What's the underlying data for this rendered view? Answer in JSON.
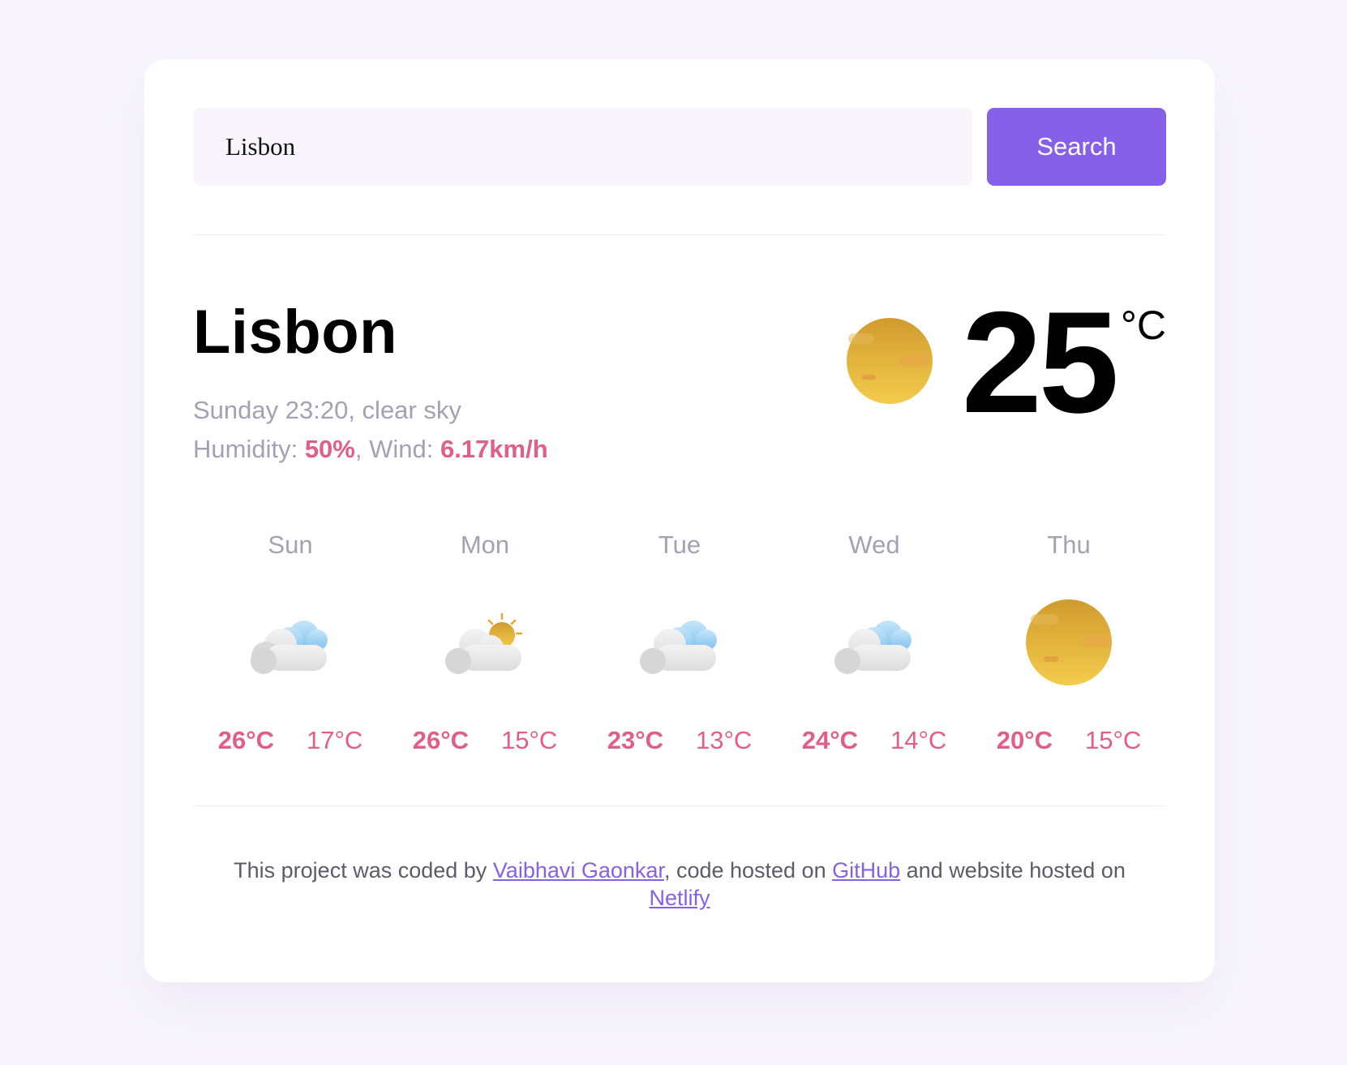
{
  "search": {
    "value": "Lisbon",
    "button_label": "Search"
  },
  "current": {
    "city": "Lisbon",
    "description": "Sunday 23:20, clear sky",
    "humidity_label": "Humidity: ",
    "humidity_value": "50%",
    "wind_label": ", Wind: ",
    "wind_value": "6.17km/h",
    "temperature": "25",
    "unit": "°C",
    "icon": "sun-icon"
  },
  "forecast": [
    {
      "day": "Sun",
      "icon": "cloud-icon",
      "max": "26°C",
      "min": "17°C"
    },
    {
      "day": "Mon",
      "icon": "partly-sunny-icon",
      "max": "26°C",
      "min": "15°C"
    },
    {
      "day": "Tue",
      "icon": "cloud-icon",
      "max": "23°C",
      "min": "13°C"
    },
    {
      "day": "Wed",
      "icon": "cloud-icon",
      "max": "24°C",
      "min": "14°C"
    },
    {
      "day": "Thu",
      "icon": "sun-icon",
      "max": "20°C",
      "min": "15°C"
    }
  ],
  "footer": {
    "prefix": "This project was coded by ",
    "author": "Vaibhavi Gaonkar",
    "middle1": ", code hosted on ",
    "github": "GitHub",
    "middle2": " and website hosted on ",
    "netlify": "Netlify"
  },
  "colors": {
    "accent": "#8660e9",
    "highlight": "#e05f86",
    "muted": "#a5a1b2",
    "background": "#f8f6fc"
  }
}
